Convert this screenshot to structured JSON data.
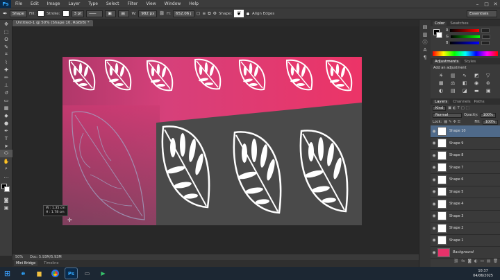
{
  "app": {
    "logo": "Ps",
    "menu": [
      "File",
      "Edit",
      "Image",
      "Layer",
      "Type",
      "Select",
      "Filter",
      "View",
      "Window",
      "Help"
    ],
    "window_controls": [
      "–",
      "□",
      "✕"
    ]
  },
  "options": {
    "mode": "Shape",
    "fill_label": "Fill:",
    "stroke_label": "Stroke:",
    "stroke_width": "3 pt",
    "w_label": "W:",
    "w_value": "982 px",
    "h_label": "H:",
    "h_value": "652.06 j",
    "shape_label": "Shape:",
    "align_edges": "Align Edges",
    "workspace": "Essentials"
  },
  "document": {
    "tab": "Untitled-1 @ 50% (Shape 10, RGB/8) *",
    "zoom": "50%",
    "doc_info": "Doc: 5.93M/5.93M"
  },
  "measure": {
    "w": "W : 1.35 cm",
    "h": "H : 1.78 cm"
  },
  "bottom_tabs": [
    "Mini Bridge",
    "Timeline"
  ],
  "color_panel": {
    "tabs": [
      "Color",
      "Swatches"
    ],
    "sliders": [
      "R",
      "G",
      "B"
    ],
    "accent": "#e8326a"
  },
  "adjust_panel": {
    "tabs": [
      "Adjustments",
      "Styles"
    ],
    "title": "Add an adjustment"
  },
  "layers_panel": {
    "tabs": [
      "Layers",
      "Channels",
      "Paths"
    ],
    "kind": "Kind",
    "blend": "Normal",
    "opacity_label": "Opacity:",
    "opacity": "100%",
    "lock_label": "Lock:",
    "fill_label": "Fill:",
    "fill": "100%",
    "layers": [
      "Shape 10",
      "Shape 9",
      "Shape 8",
      "Shape 7",
      "Shape 6",
      "Shape 5",
      "Shape 4",
      "Shape 3",
      "Shape 2",
      "Shape 1",
      "Background"
    ],
    "selected": "Shape 10"
  },
  "taskbar": {
    "time": "10:37",
    "date": "04/06/2025"
  },
  "colors": {
    "pink": "#e8326a",
    "dark": "#4a4a4a"
  },
  "icons": {
    "toolbar": [
      "move-icon",
      "marquee-icon",
      "lasso-icon",
      "quick-select-icon",
      "crop-icon",
      "eyedropper-icon",
      "heal-icon",
      "brush-icon",
      "stamp-icon",
      "history-brush-icon",
      "eraser-icon",
      "gradient-icon",
      "blur-icon",
      "dodge-icon",
      "pen-icon",
      "type-icon",
      "path-select-icon",
      "shape-icon",
      "hand-icon",
      "zoom-icon"
    ]
  }
}
